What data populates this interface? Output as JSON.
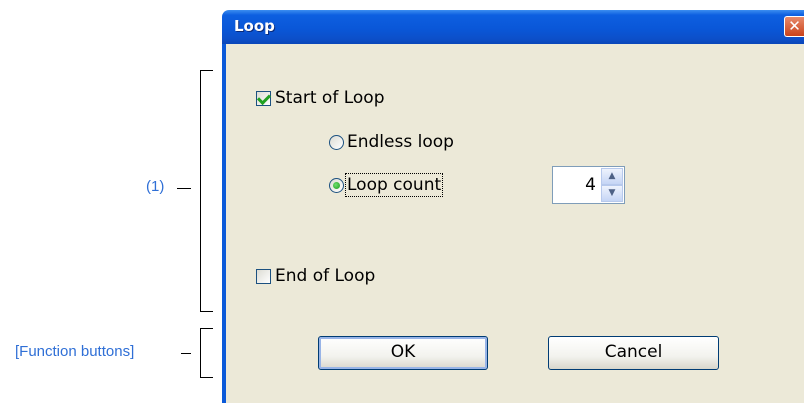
{
  "annotations": {
    "section1": "(1)",
    "function_buttons": "[Function buttons]"
  },
  "dialog": {
    "title": "Loop",
    "close_glyph": "✕",
    "start_of_loop": {
      "label": "Start of Loop",
      "checked": true
    },
    "endless_loop": {
      "label": "Endless loop",
      "selected": false
    },
    "loop_count": {
      "label": "Loop count",
      "selected": true,
      "value": "4"
    },
    "end_of_loop": {
      "label": "End of Loop",
      "checked": false
    },
    "buttons": {
      "ok": "OK",
      "cancel": "Cancel"
    }
  },
  "colors": {
    "title_bar": "#0a57d8",
    "client": "#ece9d8",
    "annotation": "#2f6fd6"
  },
  "icons": {
    "close": "close-icon",
    "spin_up": "chevron-up-icon",
    "spin_down": "chevron-down-icon"
  }
}
